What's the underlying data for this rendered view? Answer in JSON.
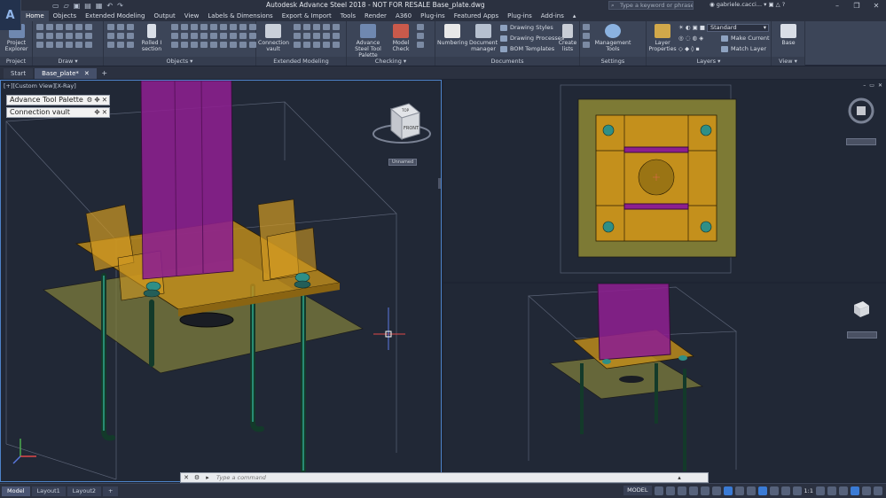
{
  "app": {
    "title": "Autodesk Advance Steel 2018 - NOT FOR RESALE    Base_plate.dwg",
    "logo": "A",
    "search_placeholder": "Type a keyword or phrase",
    "user": "gabriele.cacci...",
    "accent": "#3a7bd5"
  },
  "ribbon_tabs": [
    "Home",
    "Objects",
    "Extended Modeling",
    "Output",
    "View",
    "Labels & Dimensions",
    "Export & Import",
    "Tools",
    "Render",
    "A360",
    "Plug-ins",
    "Featured Apps",
    "Plug-ins",
    "Add-ins"
  ],
  "ribbon": {
    "project": {
      "label": "Project",
      "button": "Project Explorer"
    },
    "draw": {
      "label": "Draw"
    },
    "objects": {
      "label": "Objects",
      "button": "Rolled I section"
    },
    "extended": {
      "label": "Extended Modeling",
      "button": "Connection vault"
    },
    "checking": {
      "label": "Checking",
      "btn1": "Advance Steel Tool Palette",
      "btn2": "Model Check"
    },
    "documents": {
      "label": "Documents",
      "numbering": "Numbering",
      "doc_manager": "Document manager",
      "drawing_styles": "Drawing Styles",
      "drawing_processes": "Drawing Processes",
      "bom_templates": "BOM Templates",
      "create_lists": "Create lists"
    },
    "settings": {
      "label": "Settings",
      "button": "Management Tools"
    },
    "layers": {
      "label": "Layers",
      "button": "Layer Properties",
      "combo": "Standard",
      "make_current": "Make Current",
      "match_layer": "Match Layer"
    },
    "view": {
      "label": "View",
      "button": "Base"
    }
  },
  "doc_tabs": {
    "start": "Start",
    "active": "Base_plate*"
  },
  "viewports": {
    "left_label": "[+][Custom View][X-Ray]",
    "unnamed": "Unnamed",
    "cube_top": "TOP",
    "cube_front": "FRONT"
  },
  "palettes": {
    "tool_palette": "Advance Tool Palette",
    "connection_vault": "Connection vault"
  },
  "command": {
    "placeholder": "Type a command"
  },
  "status": {
    "layouts": [
      "Model",
      "Layout1",
      "Layout2"
    ],
    "model": "MODEL",
    "scale": "1:1"
  }
}
